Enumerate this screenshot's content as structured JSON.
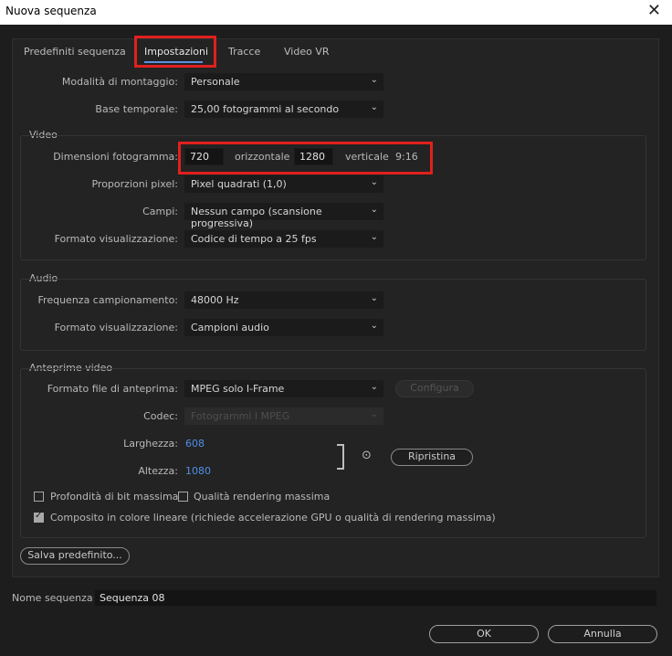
{
  "window": {
    "title": "Nuova sequenza",
    "close_glyph": "✕"
  },
  "tabs": [
    "Predefiniti sequenza",
    "Impostazioni",
    "Tracce",
    "Video VR"
  ],
  "settings": {
    "editing_mode": {
      "label": "Modalità di montaggio:",
      "value": "Personale"
    },
    "timebase": {
      "label": "Base temporale:",
      "value": "25,00  fotogrammi al secondo"
    }
  },
  "video": {
    "section": "Video",
    "frame_size_label": "Dimensioni fotogramma:",
    "horizontal_value": "720",
    "horizontal_label": "orizzontale",
    "vertical_value": "1280",
    "vertical_label": "verticale",
    "aspect": "9:16",
    "pixel_aspect": {
      "label": "Proporzioni pixel:",
      "value": "Pixel quadrati (1,0)"
    },
    "fields": {
      "label": "Campi:",
      "value": "Nessun campo (scansione progressiva)"
    },
    "display_format": {
      "label": "Formato visualizzazione:",
      "value": "Codice di tempo a 25 fps"
    }
  },
  "audio": {
    "section": "Audio",
    "sample_rate": {
      "label": "Frequenza campionamento:",
      "value": "48000 Hz"
    },
    "display_format": {
      "label": "Formato visualizzazione:",
      "value": "Campioni audio"
    }
  },
  "preview": {
    "section": "Anteprime video",
    "file_format": {
      "label": "Formato file di anteprima:",
      "value": "MPEG solo I-Frame"
    },
    "configure_label": "Configura",
    "codec": {
      "label": "Codec:",
      "value": "Fotogrammi I MPEG"
    },
    "width": {
      "label": "Larghezza:",
      "value": "608"
    },
    "height": {
      "label": "Altezza:",
      "value": "1080"
    },
    "reset_label": "Ripristina"
  },
  "options": {
    "max_bit_depth": {
      "label": "Profondità di bit massima",
      "checked": false
    },
    "max_render_quality": {
      "label": "Qualità rendering massima",
      "checked": false
    },
    "linear_color": {
      "label": "Composito in colore lineare (richiede accelerazione GPU o qualità di rendering massima)",
      "checked": true
    }
  },
  "save_preset_label": "Salva predefinito...",
  "sequence_name": {
    "label": "Nome sequenza:",
    "value": "Sequenza 08"
  },
  "buttons": {
    "ok": "OK",
    "cancel": "Annulla"
  },
  "colors": {
    "accent": "#5b8fe0",
    "highlight": "#e0201d",
    "value_blue": "#4f8fe8"
  }
}
